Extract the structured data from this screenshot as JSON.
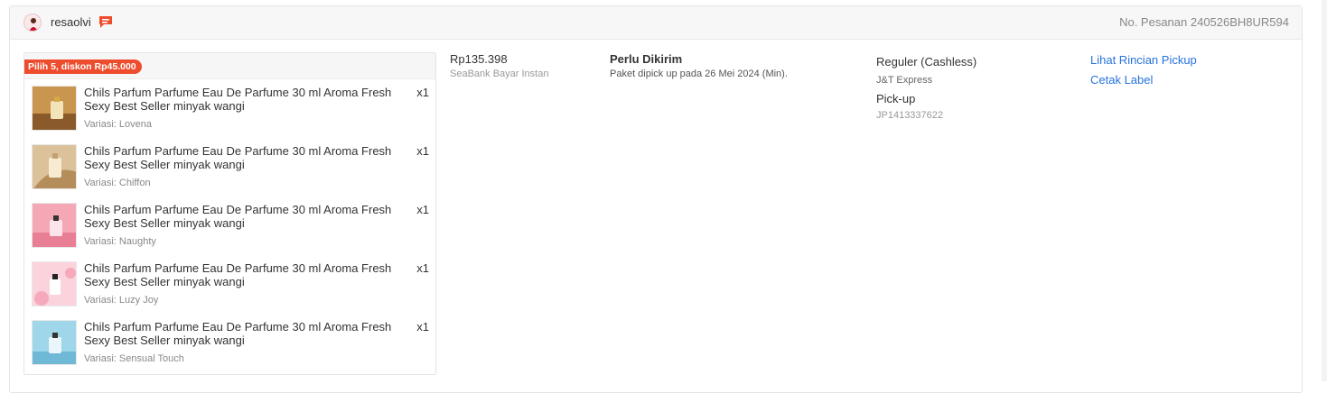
{
  "header": {
    "username": "resaolvi",
    "order_number": "No. Pesanan 240526BH8UR594"
  },
  "promo_label": "Pilih 5, diskon Rp45.000",
  "items": [
    {
      "name": "Chils Parfum Parfume Eau De Parfume 30 ml Aroma Fresh Sexy Best Seller minyak wangi",
      "qty": "x1",
      "variant": "Variasi: Lovena"
    },
    {
      "name": "Chils Parfum Parfume Eau De Parfume 30 ml Aroma Fresh Sexy Best Seller minyak wangi",
      "qty": "x1",
      "variant": "Variasi: Chiffon"
    },
    {
      "name": "Chils Parfum Parfume Eau De Parfume 30 ml Aroma Fresh Sexy Best Seller minyak wangi",
      "qty": "x1",
      "variant": "Variasi: Naughty"
    },
    {
      "name": "Chils Parfum Parfume Eau De Parfume 30 ml Aroma Fresh Sexy Best Seller minyak wangi",
      "qty": "x1",
      "variant": "Variasi: Luzy Joy"
    },
    {
      "name": "Chils Parfum Parfume Eau De Parfume 30 ml Aroma Fresh Sexy Best Seller minyak wangi",
      "qty": "x1",
      "variant": "Variasi: Sensual Touch"
    }
  ],
  "payment": {
    "price": "Rp135.398",
    "method": "SeaBank Bayar Instan"
  },
  "status": {
    "title": "Perlu Dikirim",
    "desc": "Paket dipick up pada 26 Mei 2024 (Min)."
  },
  "shipping": {
    "type": "Reguler (Cashless)",
    "courier": "J&T Express",
    "method": "Pick-up",
    "tracking": "JP1413337622"
  },
  "actions": {
    "view_pickup": "Lihat Rincian Pickup",
    "print_label": "Cetak Label"
  },
  "colors": {
    "accent": "#ee4d2d",
    "link": "#2673dd"
  },
  "icons": [
    "avatar",
    "chat-icon"
  ]
}
